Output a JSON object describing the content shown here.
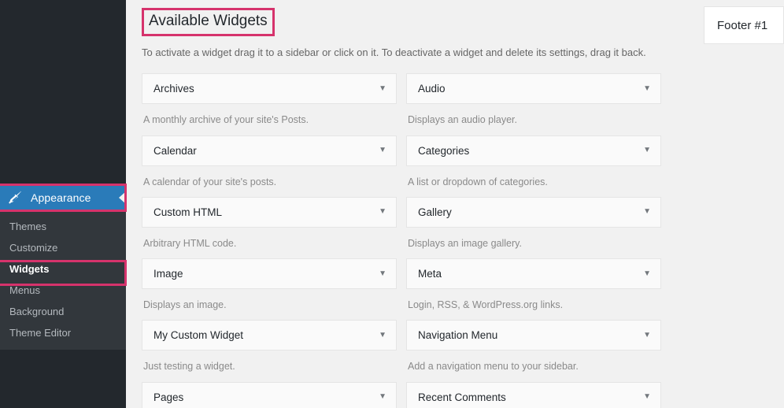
{
  "sidebar": {
    "appearance": {
      "label": "Appearance",
      "icon": "paintbrush-icon",
      "collapse_icon": "left-arrow-icon",
      "active_color": "#2a7bb9"
    },
    "submenu": [
      {
        "label": "Themes",
        "current": false
      },
      {
        "label": "Customize",
        "current": false
      },
      {
        "label": "Widgets",
        "current": true
      },
      {
        "label": "Menus",
        "current": false
      },
      {
        "label": "Background",
        "current": false
      },
      {
        "label": "Theme Editor",
        "current": false
      }
    ],
    "highlight_color": "#d6336c"
  },
  "main": {
    "title": "Available Widgets",
    "description": "To activate a widget drag it to a sidebar or click on it. To deactivate a widget and delete its settings, drag it back.",
    "widget_arrow_icon": "chevron-down-icon",
    "columns": [
      {
        "widgets": [
          {
            "name": "Archives",
            "description": "A monthly archive of your site's Posts."
          },
          {
            "name": "Calendar",
            "description": "A calendar of your site's posts."
          },
          {
            "name": "Custom HTML",
            "description": "Arbitrary HTML code."
          },
          {
            "name": "Image",
            "description": "Displays an image."
          },
          {
            "name": "My Custom Widget",
            "description": "Just testing a widget."
          },
          {
            "name": "Pages",
            "description": ""
          }
        ]
      },
      {
        "widgets": [
          {
            "name": "Audio",
            "description": "Displays an audio player."
          },
          {
            "name": "Categories",
            "description": "A list or dropdown of categories."
          },
          {
            "name": "Gallery",
            "description": "Displays an image gallery."
          },
          {
            "name": "Meta",
            "description": "Login, RSS, & WordPress.org links."
          },
          {
            "name": "Navigation Menu",
            "description": "Add a navigation menu to your sidebar."
          },
          {
            "name": "Recent Comments",
            "description": ""
          }
        ]
      }
    ]
  },
  "right_panel": {
    "sidebar_name": "Footer #1"
  }
}
